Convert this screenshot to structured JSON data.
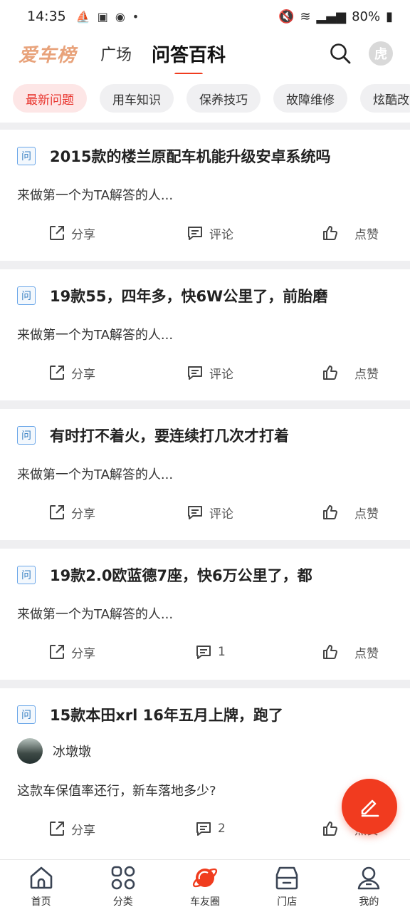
{
  "status_bar": {
    "time": "14:35",
    "battery": "80%"
  },
  "header": {
    "logo": "爱车榜",
    "tabs": [
      {
        "label": "广场"
      },
      {
        "label": "问答百科"
      }
    ],
    "avatar_text": "虎"
  },
  "chips": [
    "最新问题",
    "用车知识",
    "保养技巧",
    "故障维修",
    "炫酷改"
  ],
  "badge_text": "问",
  "cards": [
    {
      "title": "2015款的楼兰原配车机能升级安卓系统吗",
      "subtitle": "来做第一个为TA解答的人...",
      "share": "分享",
      "comment": "评论",
      "like": "点赞"
    },
    {
      "title": "19款55，四年多，快6W公里了，前胎磨",
      "subtitle": "来做第一个为TA解答的人...",
      "share": "分享",
      "comment": "评论",
      "like": "点赞"
    },
    {
      "title": "有时打不着火，要连续打几次才打着",
      "subtitle": "来做第一个为TA解答的人...",
      "share": "分享",
      "comment": "评论",
      "like": "点赞"
    },
    {
      "title": "19款2.0欧蓝德7座，快6万公里了，都",
      "subtitle": "来做第一个为TA解答的人...",
      "share": "分享",
      "comment": "1",
      "like": "点赞"
    },
    {
      "title": "15款本田xrl  16年五月上牌，跑了",
      "author": "冰墩墩",
      "subtitle": "这款车保值率还行，新车落地多少?",
      "share": "分享",
      "comment": "2",
      "like": "点赞"
    }
  ],
  "tabbar": [
    {
      "label": "首页"
    },
    {
      "label": "分类"
    },
    {
      "label": "车友圈"
    },
    {
      "label": "门店"
    },
    {
      "label": "我的"
    }
  ],
  "colors": {
    "accent": "#f03c1e",
    "logo": "#e8a27a",
    "chip_active_bg": "#fde6e6",
    "chip_active_text": "#e8312a"
  }
}
